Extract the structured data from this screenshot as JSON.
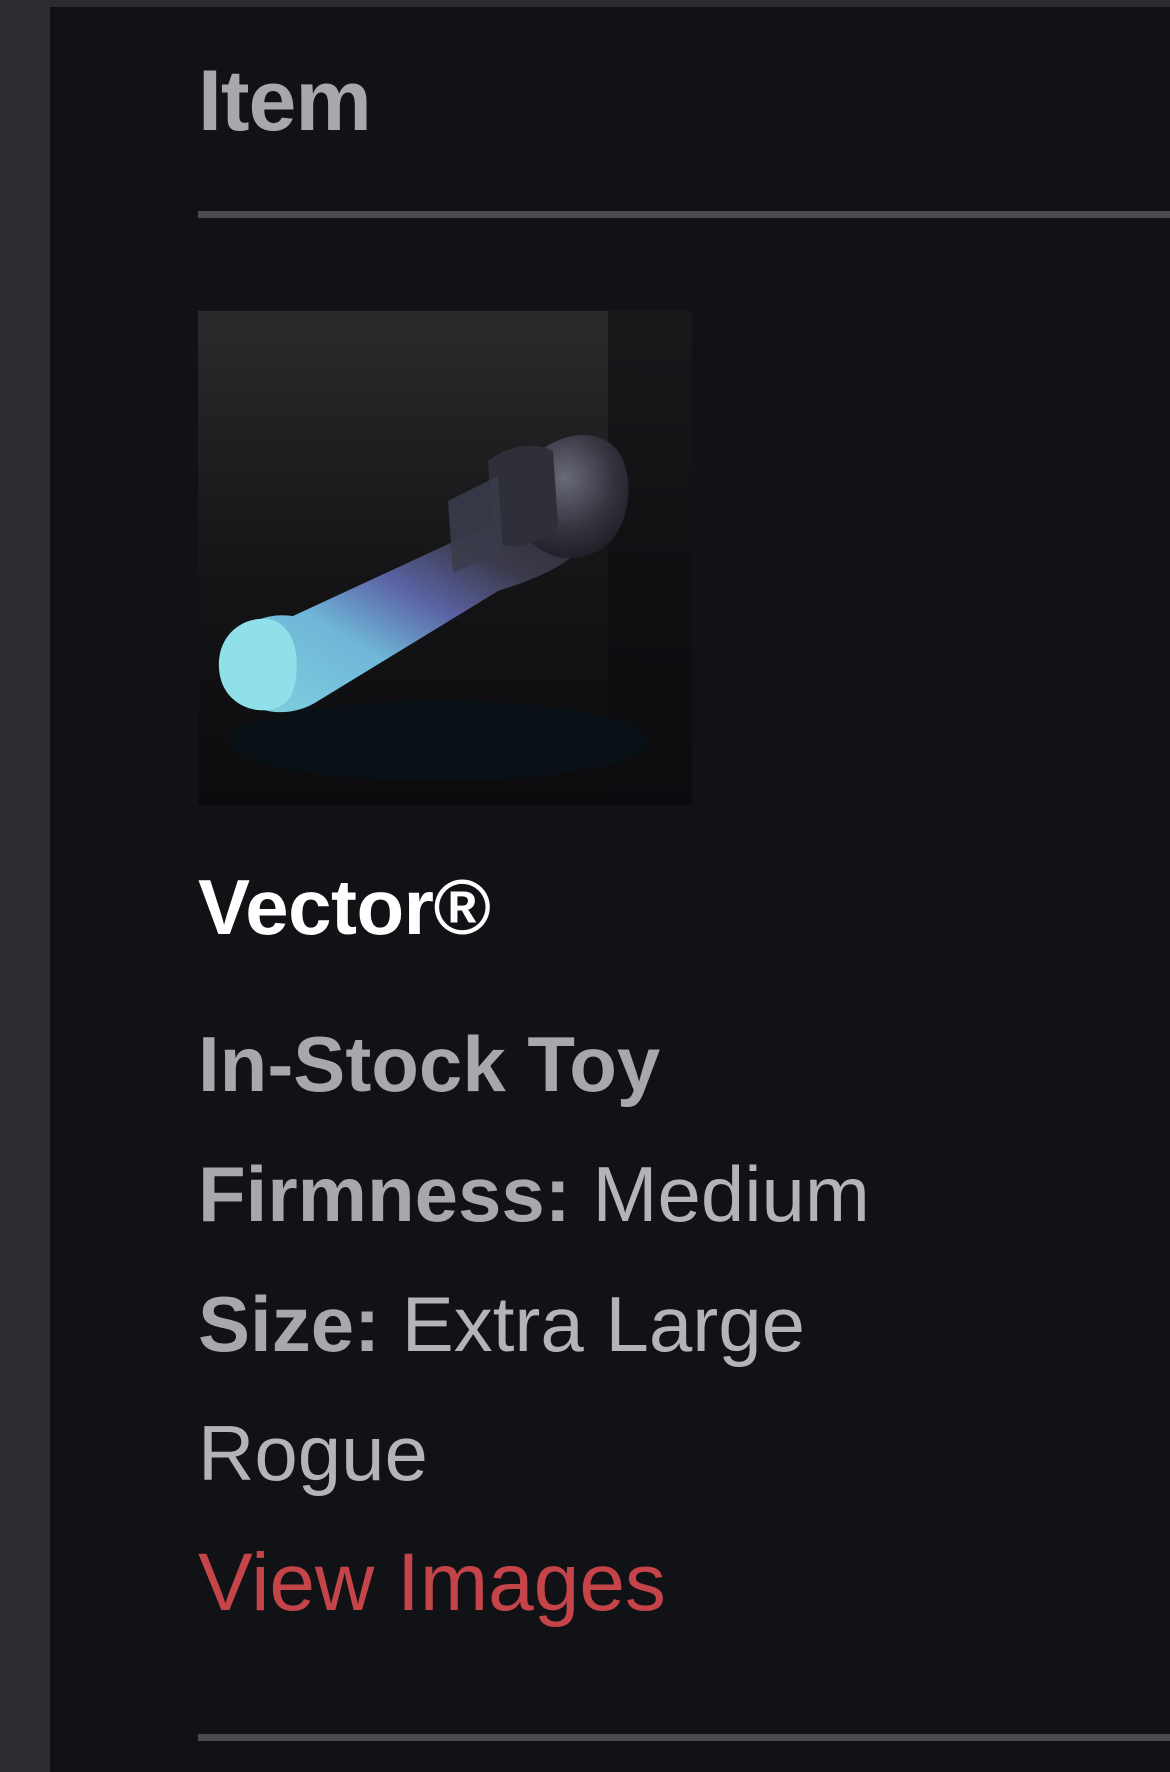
{
  "cart": {
    "column_header": "Item",
    "item": {
      "image_alt": "",
      "name": "Vector®",
      "availability": "In-Stock Toy",
      "firmness": {
        "label": "Firmness:",
        "value": "Medium"
      },
      "size": {
        "label": "Size:",
        "value": "Extra Large"
      },
      "variant": "Rogue",
      "view_images_label": "View Images"
    }
  },
  "colors": {
    "background": "#111215",
    "left_rail": "#2c2d31",
    "header_text": "#a7a8ab",
    "divider": "#4a4b50",
    "link": "#c4444a"
  }
}
